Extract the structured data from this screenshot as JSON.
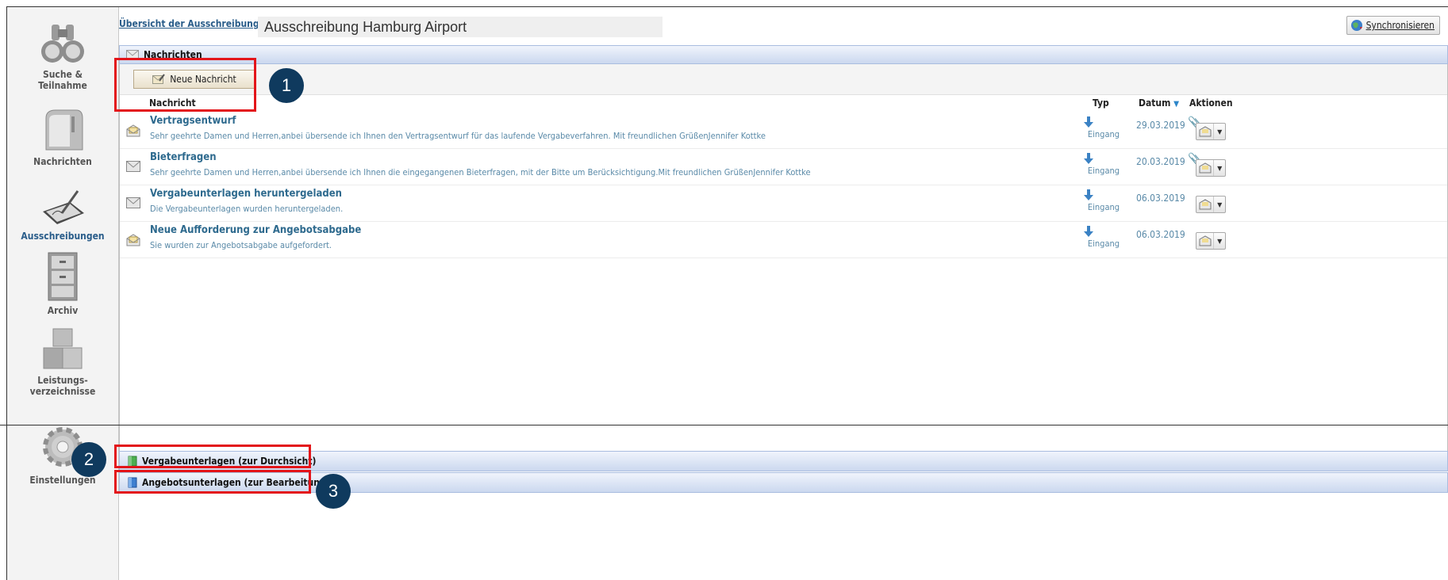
{
  "sidebar": {
    "items": [
      {
        "label": "Suche &\nTeilnahme"
      },
      {
        "label": "Nachrichten"
      },
      {
        "label": "Ausschreibungen"
      },
      {
        "label": "Archiv"
      },
      {
        "label": "Leistungs-\nverzeichnisse"
      },
      {
        "label": "Einstellungen"
      }
    ]
  },
  "header": {
    "overview_link": "Übersicht der Ausschreibungen",
    "title": "Ausschreibung Hamburg Airport",
    "sync_label": "Synchronisieren"
  },
  "messages": {
    "panel_title": "Nachrichten",
    "new_button": "Neue Nachricht",
    "columns": {
      "nachricht": "Nachricht",
      "typ": "Typ",
      "datum": "Datum",
      "aktionen": "Aktionen"
    },
    "rows": [
      {
        "subject": "Vertragsentwurf",
        "preview": "Sehr geehrte Damen und Herren,anbei übersende ich Ihnen den Vertragsentwurf für das laufende Vergabeverfahren. Mit freundlichen GrüßenJennifer Kottke",
        "typ": "Eingang",
        "date": "29.03.2019",
        "attachment": true,
        "status": "opened"
      },
      {
        "subject": "Bieterfragen",
        "preview": "Sehr geehrte Damen und Herren,anbei übersende ich Ihnen die eingegangenen Bieterfragen, mit der Bitte um Berücksichtigung.Mit freundlichen GrüßenJennifer Kottke",
        "typ": "Eingang",
        "date": "20.03.2019",
        "attachment": true,
        "status": "closed"
      },
      {
        "subject": "Vergabeunterlagen heruntergeladen",
        "preview": "Die Vergabeunterlagen wurden heruntergeladen.",
        "typ": "Eingang",
        "date": "06.03.2019",
        "attachment": false,
        "status": "closed"
      },
      {
        "subject": "Neue Aufforderung zur Angebotsabgabe",
        "preview": "Sie wurden zur Angebotsabgabe aufgefordert.",
        "typ": "Eingang",
        "date": "06.03.2019",
        "attachment": false,
        "status": "opened"
      }
    ]
  },
  "bottom_panels": {
    "vergabe": "Vergabeunterlagen (zur Durchsicht)",
    "angebot": "Angebotsunterlagen (zur Bearbeitung)"
  },
  "callouts": {
    "one": "1",
    "two": "2",
    "three": "3"
  },
  "colors": {
    "highlight": "#e3151a",
    "badge": "#0f3a5e",
    "link": "#2a5d8a"
  }
}
